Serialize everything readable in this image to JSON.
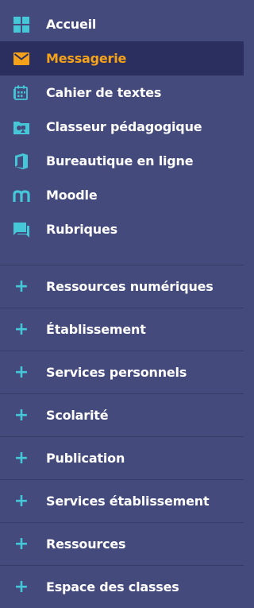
{
  "colors": {
    "background": "#444a7c",
    "active_bg": "#2a2f5f",
    "active_text": "#f5a21a",
    "icon": "#45c7d8",
    "divider": "#353a66"
  },
  "menu": [
    {
      "label": "Accueil",
      "icon": "grid-icon"
    },
    {
      "label": "Messagerie",
      "icon": "envelope-icon",
      "active": true
    },
    {
      "label": "Cahier de textes",
      "icon": "calendar-icon"
    },
    {
      "label": "Classeur pédagogique",
      "icon": "folder-shapes-icon"
    },
    {
      "label": "Bureautique en ligne",
      "icon": "office-icon"
    },
    {
      "label": "Moodle",
      "icon": "moodle-icon"
    },
    {
      "label": "Rubriques",
      "icon": "chat-icon"
    }
  ],
  "sections": [
    {
      "label": "Ressources numériques",
      "icon": "plus-icon"
    },
    {
      "label": "Établissement",
      "icon": "plus-icon"
    },
    {
      "label": "Services personnels",
      "icon": "plus-icon"
    },
    {
      "label": "Scolarité",
      "icon": "plus-icon"
    },
    {
      "label": "Publication",
      "icon": "plus-icon"
    },
    {
      "label": "Services établissement",
      "icon": "plus-icon"
    },
    {
      "label": "Ressources",
      "icon": "plus-icon"
    },
    {
      "label": "Espace des classes",
      "icon": "plus-icon"
    }
  ],
  "plus_symbol": "+"
}
